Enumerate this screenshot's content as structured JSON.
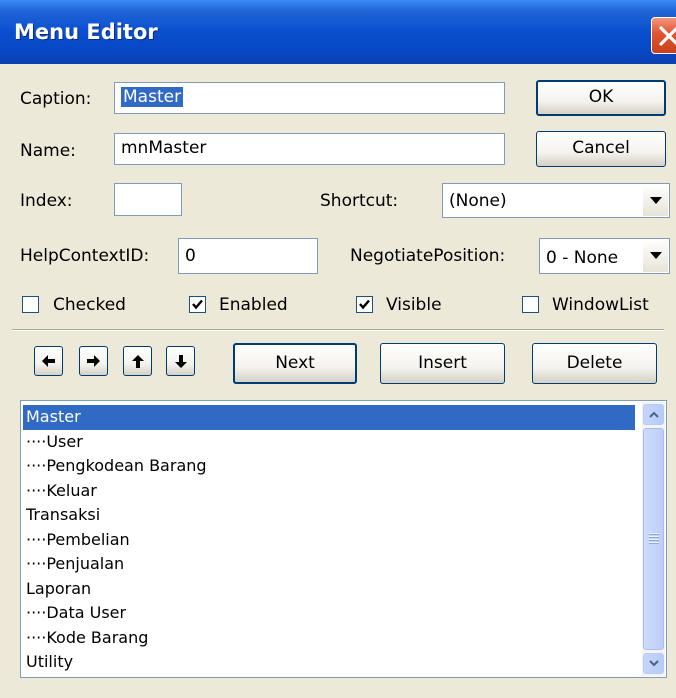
{
  "window": {
    "title": "Menu Editor"
  },
  "fields": {
    "caption_label": "Caption:",
    "caption_value": "Master",
    "name_label": "Name:",
    "name_value": "mnMaster",
    "index_label": "Index:",
    "index_value": "",
    "shortcut_label": "Shortcut:",
    "shortcut_value": "(None)",
    "helpcontext_label": "HelpContextID:",
    "helpcontext_value": "0",
    "negotiate_label": "NegotiatePosition:",
    "negotiate_value": "0 - None"
  },
  "buttons": {
    "ok": "OK",
    "cancel": "Cancel",
    "next": "Next",
    "insert": "Insert",
    "delete": "Delete"
  },
  "checkboxes": [
    {
      "label": "Checked",
      "checked": false
    },
    {
      "label": "Enabled",
      "checked": true
    },
    {
      "label": "Visible",
      "checked": true
    },
    {
      "label": "WindowList",
      "checked": false
    }
  ],
  "arrow_buttons": [
    "arrow-left-icon",
    "arrow-right-icon",
    "arrow-up-icon",
    "arrow-down-icon"
  ],
  "menu_items": [
    {
      "text": "Master",
      "selected": true
    },
    {
      "text": "····User",
      "selected": false
    },
    {
      "text": "····Pengkodean Barang",
      "selected": false
    },
    {
      "text": "····Keluar",
      "selected": false
    },
    {
      "text": "Transaksi",
      "selected": false
    },
    {
      "text": "····Pembelian",
      "selected": false
    },
    {
      "text": "····Penjualan",
      "selected": false
    },
    {
      "text": "Laporan",
      "selected": false
    },
    {
      "text": "····Data User",
      "selected": false
    },
    {
      "text": "····Kode Barang",
      "selected": false
    },
    {
      "text": "Utility",
      "selected": false
    }
  ],
  "colors": {
    "titlebar": "#0a4fd0",
    "selection": "#316ac5",
    "dialog_bg": "#ece9d8"
  }
}
